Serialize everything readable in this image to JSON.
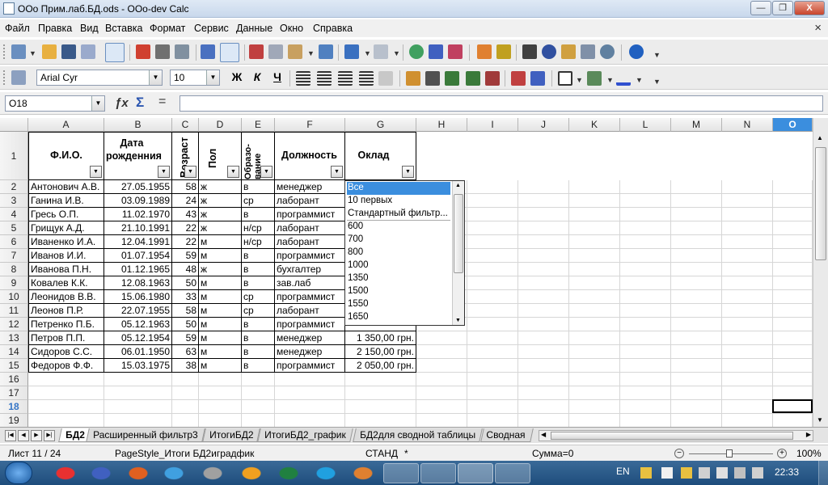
{
  "window": {
    "title": "ООо Прим.лаб.БД.ods - OOo-dev Calc",
    "min": "—",
    "max": "❐",
    "close": "X"
  },
  "menu": [
    "Файл",
    "Правка",
    "Вид",
    "Вставка",
    "Формат",
    "Сервис",
    "Данные",
    "Окно",
    "Справка"
  ],
  "menu_close": "×",
  "font": {
    "name": "Arial Cyr",
    "size": "10"
  },
  "fmt_labels": {
    "bold": "Ж",
    "italic": "К",
    "underline": "Ч"
  },
  "formula": {
    "cellref": "O18",
    "input": ""
  },
  "columns": [
    "A",
    "B",
    "C",
    "D",
    "E",
    "F",
    "G",
    "H",
    "I",
    "J",
    "K",
    "L",
    "M",
    "N",
    "O"
  ],
  "header_row": {
    "fio": "Ф.И.О.",
    "dob": "Дата рожденния",
    "age": "Возраст",
    "sex": "Пол",
    "edu": "Образо-вание",
    "post": "Должность",
    "salary": "Оклад"
  },
  "rows": [
    {
      "n": "2",
      "fio": "Антонович А.В.",
      "dob": "27.05.1955",
      "age": "58",
      "sex": "ж",
      "edu": "в",
      "post": "менеджер",
      "sal": ""
    },
    {
      "n": "3",
      "fio": "Ганина И.В.",
      "dob": "03.09.1989",
      "age": "24",
      "sex": "ж",
      "edu": "ср",
      "post": "лаборант",
      "sal": ""
    },
    {
      "n": "4",
      "fio": "Гресь О.П.",
      "dob": "11.02.1970",
      "age": "43",
      "sex": "ж",
      "edu": "в",
      "post": "программист",
      "sal": ""
    },
    {
      "n": "5",
      "fio": "Грищук А.Д.",
      "dob": "21.10.1991",
      "age": "22",
      "sex": "ж",
      "edu": "н/ср",
      "post": "лаборант",
      "sal": ""
    },
    {
      "n": "6",
      "fio": "Иваненко И.А.",
      "dob": "12.04.1991",
      "age": "22",
      "sex": "м",
      "edu": "н/ср",
      "post": "лаборант",
      "sal": ""
    },
    {
      "n": "7",
      "fio": "Иванов И.И.",
      "dob": "01.07.1954",
      "age": "59",
      "sex": "м",
      "edu": "в",
      "post": "программист",
      "sal": ""
    },
    {
      "n": "8",
      "fio": "Иванова П.Н.",
      "dob": "01.12.1965",
      "age": "48",
      "sex": "ж",
      "edu": "в",
      "post": "бухгалтер",
      "sal": ""
    },
    {
      "n": "9",
      "fio": "Ковалев К.К.",
      "dob": "12.08.1963",
      "age": "50",
      "sex": "м",
      "edu": "в",
      "post": "зав.лаб",
      "sal": ""
    },
    {
      "n": "10",
      "fio": "Леонидов В.В.",
      "dob": "15.06.1980",
      "age": "33",
      "sex": "м",
      "edu": "ср",
      "post": "программист",
      "sal": ""
    },
    {
      "n": "11",
      "fio": "Леонов П.Р.",
      "dob": "22.07.1955",
      "age": "58",
      "sex": "м",
      "edu": "ср",
      "post": "лаборант",
      "sal": ""
    },
    {
      "n": "12",
      "fio": "Петренко П.Б.",
      "dob": "05.12.1963",
      "age": "50",
      "sex": "м",
      "edu": "в",
      "post": "программист",
      "sal": ""
    },
    {
      "n": "13",
      "fio": "Петров П.П.",
      "dob": "05.12.1954",
      "age": "59",
      "sex": "м",
      "edu": "в",
      "post": "менеджер",
      "sal": "1 350,00 грн."
    },
    {
      "n": "14",
      "fio": "Сидоров С.С.",
      "dob": "06.01.1950",
      "age": "63",
      "sex": "м",
      "edu": "в",
      "post": "менеджер",
      "sal": "2 150,00 грн."
    },
    {
      "n": "15",
      "fio": "Федоров Ф.Ф.",
      "dob": "15.03.1975",
      "age": "38",
      "sex": "м",
      "edu": "в",
      "post": "программист",
      "sal": "2 050,00 грн."
    }
  ],
  "empty_rows": [
    "16",
    "17",
    "18",
    "19"
  ],
  "filter_dropdown": {
    "items": [
      "Все",
      "10 первых",
      "Стандартный фильтр...",
      "600",
      "700",
      "800",
      "1000",
      "1350",
      "1500",
      "1550",
      "1650"
    ],
    "selected": "Все"
  },
  "sheet_tabs": [
    "БД2",
    "Расширенный фильтр3",
    "ИтогиБД2",
    "ИтогиБД2_график",
    "БД2для сводной таблицы",
    "Сводная т"
  ],
  "active_tab": "БД2",
  "status": {
    "sheet": "Лист 11 / 24",
    "style": "PageStyle_Итоги БД2иградфик",
    "mode": "СТАНД",
    "star": "*",
    "sum": "Сумма=0",
    "zoom": "100%"
  },
  "taskbar": {
    "lang": "EN",
    "time": "22:33"
  },
  "colors": {
    "accent": "#3b8ede",
    "taskbar": "#1e4d7c"
  }
}
